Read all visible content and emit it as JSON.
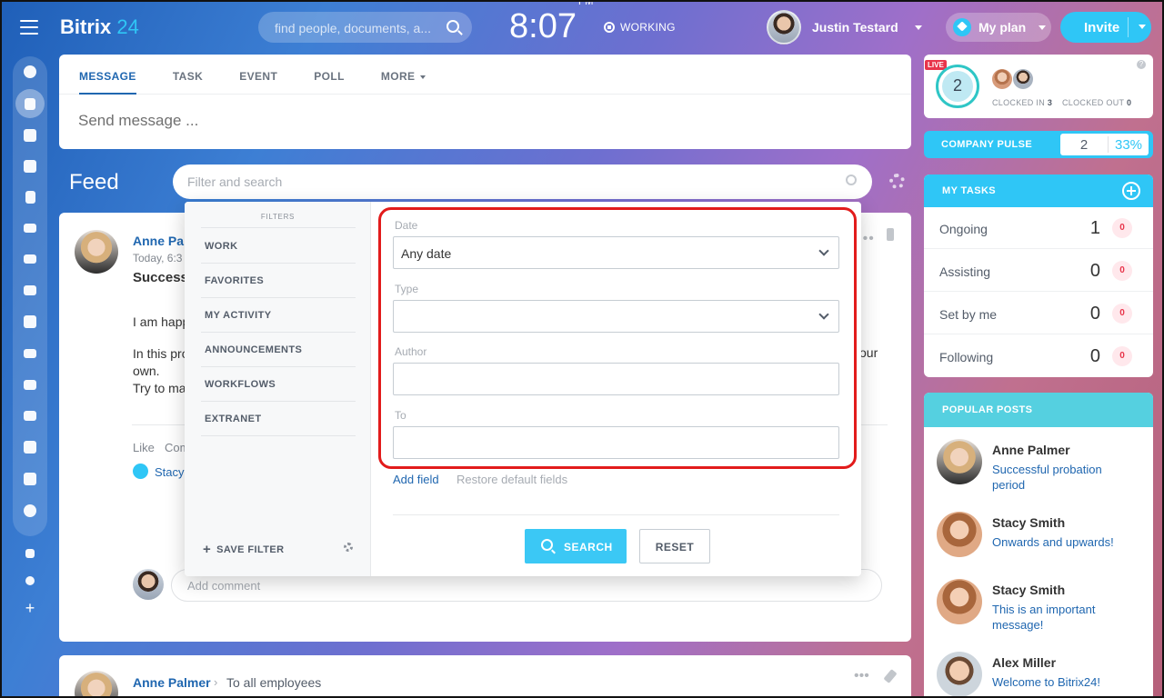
{
  "header": {
    "logo_name": "Bitrix",
    "logo_num": "24",
    "search_placeholder": "find people, documents, a...",
    "time": "8:07",
    "ampm": "PM",
    "status": "WORKING",
    "user_name": "Justin Testard",
    "plan_label": "My plan",
    "invite_label": "Invite"
  },
  "composer": {
    "tabs": [
      "MESSAGE",
      "TASK",
      "EVENT",
      "POLL",
      "MORE"
    ],
    "active_tab": "MESSAGE",
    "placeholder": "Send message ..."
  },
  "feed": {
    "title": "Feed",
    "filter_placeholder": "Filter and search"
  },
  "post": {
    "author": "Anne Pal",
    "time": "Today, 6:3",
    "title": "Success",
    "para1": "I am happ",
    "para2a": "In this pro",
    "para2_end": "our",
    "para2b": "own.",
    "para2c": "Try to ma",
    "like": "Like",
    "comment": "Com",
    "liker": "Stacy",
    "comment_placeholder": "Add comment"
  },
  "post2": {
    "author": "Anne Palmer",
    "to": "To all employees"
  },
  "filter_popup": {
    "heading": "FILTERS",
    "presets": [
      "WORK",
      "FAVORITES",
      "MY ACTIVITY",
      "ANNOUNCEMENTS",
      "WORKFLOWS",
      "EXTRANET"
    ],
    "save_filter": "SAVE FILTER",
    "fields": {
      "date_label": "Date",
      "date_value": "Any date",
      "type_label": "Type",
      "type_value": "",
      "author_label": "Author",
      "author_value": "",
      "to_label": "To",
      "to_value": ""
    },
    "add_field": "Add field",
    "restore": "Restore default fields",
    "search_btn": "SEARCH",
    "reset_btn": "RESET",
    "highlight_color": "#e21b1b"
  },
  "clock_widget": {
    "live": "LIVE",
    "count": "2",
    "clocked_in_label": "CLOCKED IN",
    "clocked_in": "3",
    "clocked_out_label": "CLOCKED OUT",
    "clocked_out": "0"
  },
  "pulse": {
    "label": "COMPANY PULSE",
    "value": "2",
    "percent": "33%"
  },
  "tasks": {
    "title": "MY TASKS",
    "rows": [
      {
        "label": "Ongoing",
        "count": "1",
        "badge": "0"
      },
      {
        "label": "Assisting",
        "count": "0",
        "badge": "0"
      },
      {
        "label": "Set by me",
        "count": "0",
        "badge": "0"
      },
      {
        "label": "Following",
        "count": "0",
        "badge": "0"
      }
    ]
  },
  "popular": {
    "title": "POPULAR POSTS",
    "posts": [
      {
        "name": "Anne Palmer",
        "text": "Successful probation period"
      },
      {
        "name": "Stacy Smith",
        "text": "Onwards and upwards!"
      },
      {
        "name": "Stacy Smith",
        "text": "This is an important message!"
      },
      {
        "name": "Alex Miller",
        "text": "Welcome to Bitrix24!"
      }
    ]
  },
  "colors": {
    "accent": "#2fc6f6",
    "link": "#2067b0",
    "alert": "#e8354b"
  }
}
